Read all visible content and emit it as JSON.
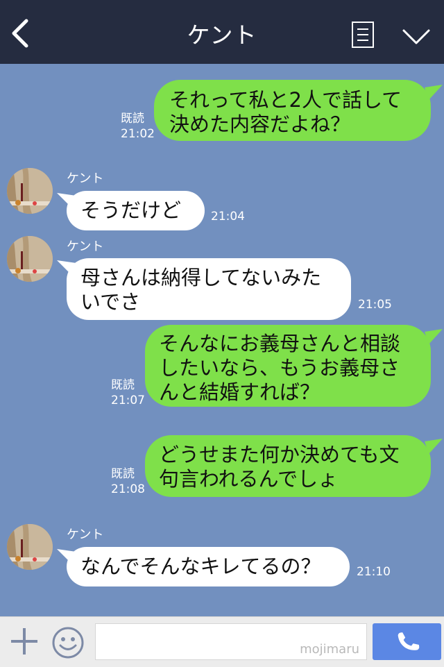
{
  "header": {
    "title": "ケント"
  },
  "messages": [
    {
      "text": "それって私と2人で話して\n決めた内容だよね？",
      "read": "既読",
      "time": "21:02"
    },
    {
      "sender": "ケント",
      "text": "そうだけど",
      "time": "21:04"
    },
    {
      "sender": "ケント",
      "text": "母さんは納得してないみた\nいでさ",
      "time": "21:05"
    },
    {
      "text": "そんなにお義母さんと相談\nしたいなら、もうお義母さ\nんと結婚すれば？",
      "read": "既読",
      "time": "21:07"
    },
    {
      "text": "どうせまた何か決めても文\n句言われるんでしょ",
      "read": "既読",
      "time": "21:08"
    },
    {
      "sender": "ケント",
      "text": "なんでそんなキレてるの？",
      "time": "21:10"
    }
  ],
  "footer": {
    "watermark": "mojimaru"
  },
  "colors": {
    "header_bg": "#252c40",
    "chat_bg": "#7290bf",
    "my_bubble": "#7fe04a",
    "their_bubble": "#ffffff",
    "call_button": "#5b87e4"
  }
}
